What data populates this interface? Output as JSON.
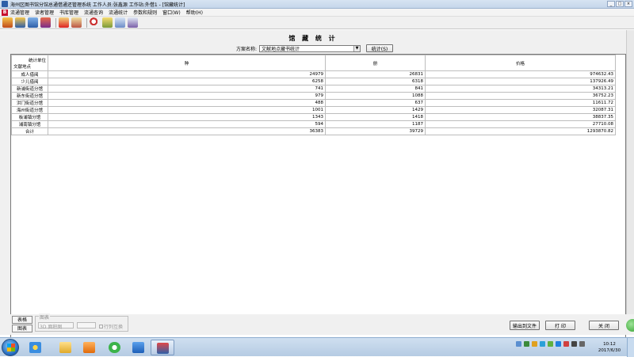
{
  "window": {
    "title": "海州区图书馆分馆总通借通还管理系统 工作人员:张鑫源 工作站:外借1 - [馆藏统计]",
    "buttons": [
      "_",
      "□",
      "×"
    ]
  },
  "menu": [
    "流通管理",
    "读者管理",
    "书库管理",
    "流通查询",
    "流通统计",
    "参数和规则",
    "窗口(W)",
    "帮助(H)"
  ],
  "toolbar_icons": [
    "library-icon",
    "library-icon",
    "library-icon",
    "library-icon",
    "reader-icon",
    "card-icon",
    "search-icon",
    "lamp-icon",
    "chart-icon",
    "report-icon"
  ],
  "page": {
    "heading": "馆 藏 统 计",
    "scheme_label": "方案名称:",
    "scheme_value": "文献地点藏书统计",
    "stat_button": "统计(S)"
  },
  "table": {
    "corner_top": "统计单位",
    "corner_bottom": "文献地点",
    "columns": [
      "种",
      "册",
      "价格"
    ],
    "rows": [
      {
        "name": "成人借阅",
        "c1": "24979",
        "c2": "26831",
        "c3": "974632.43"
      },
      {
        "name": "少儿借阅",
        "c1": "6258",
        "c2": "6318",
        "c3": "137926.49"
      },
      {
        "name": "新浦街道分馆",
        "c1": "741",
        "c2": "841",
        "c3": "34313.21"
      },
      {
        "name": "新东街道分馆",
        "c1": "979",
        "c2": "1088",
        "c3": "36752.23"
      },
      {
        "name": "洪门街道分馆",
        "c1": "488",
        "c2": "637",
        "c3": "11611.72"
      },
      {
        "name": "海州街道分馆",
        "c1": "1001",
        "c2": "1429",
        "c3": "32087.31"
      },
      {
        "name": "板浦镇分馆",
        "c1": "1343",
        "c2": "1418",
        "c3": "38837.35"
      },
      {
        "name": "浦南镇分馆",
        "c1": "594",
        "c2": "1187",
        "c3": "27710.08"
      },
      {
        "name": "合计",
        "c1": "36383",
        "c2": "39729",
        "c3": "1293870.82"
      }
    ]
  },
  "bottom": {
    "tab_table": "表格",
    "tab_chart": "图表",
    "chart_group_label": "图表",
    "chart_type": "3D 面积图",
    "row_col_swap": "行列互换",
    "export_button": "输出到文件",
    "print_button": "打 印",
    "close_button": "关 闭"
  },
  "taskbar": {
    "time": "10:12",
    "date": "2017/6/30"
  }
}
